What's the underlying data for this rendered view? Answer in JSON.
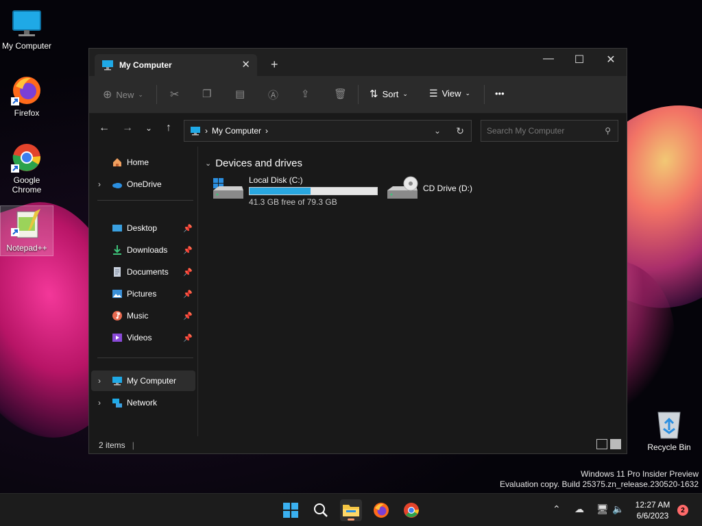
{
  "desktop": {
    "icons": [
      {
        "label": "My Computer",
        "icon": "monitor-icon"
      },
      {
        "label": "Firefox",
        "icon": "firefox-icon"
      },
      {
        "label": "Google Chrome",
        "icon": "chrome-icon"
      },
      {
        "label": "Notepad++",
        "icon": "notepadpp-icon"
      }
    ],
    "recycle_bin": "Recycle Bin"
  },
  "window": {
    "tab_title": "My Computer",
    "new_tab": "+",
    "controls": {
      "minimize": "—",
      "maximize": "☐",
      "close": "✕"
    }
  },
  "toolbar": {
    "new_label": "New",
    "sort_label": "Sort",
    "view_label": "View",
    "more_label": "•••"
  },
  "address": {
    "crumb": "My Computer",
    "search_placeholder": "Search My Computer"
  },
  "nav": {
    "home": "Home",
    "onedrive": "OneDrive",
    "quick": [
      {
        "label": "Desktop"
      },
      {
        "label": "Downloads"
      },
      {
        "label": "Documents"
      },
      {
        "label": "Pictures"
      },
      {
        "label": "Music"
      },
      {
        "label": "Videos"
      }
    ],
    "my_computer": "My Computer",
    "network": "Network"
  },
  "content": {
    "group_title": "Devices and drives",
    "drives": [
      {
        "name": "Local Disk (C:)",
        "free_text": "41.3 GB free of 79.3 GB",
        "used_fraction": 0.48
      },
      {
        "name": "CD Drive (D:)"
      }
    ]
  },
  "status": {
    "items": "2 items"
  },
  "watermark": {
    "line1": "Windows 11 Pro Insider Preview",
    "line2": "Evaluation copy. Build 25375.zn_release.230520-1632"
  },
  "taskbar": {
    "time": "12:27 AM",
    "date": "6/6/2023",
    "notifications": "2"
  },
  "colors": {
    "accent": "#29a7e0",
    "badge": "#ff6a6a"
  }
}
